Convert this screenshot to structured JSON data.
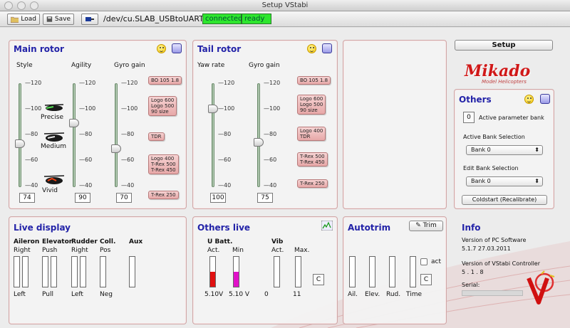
{
  "window": {
    "title": "Setup VStabi"
  },
  "toolbar": {
    "load_label": "Load",
    "save_label": "Save",
    "path": "/dev/cu.SLAB_USBtoUART",
    "status_connected": "connected",
    "status_ready": "ready"
  },
  "main_rotor": {
    "title": "Main rotor",
    "cols": {
      "style": "Style",
      "agility": "Agility",
      "gyro": "Gyro gain"
    },
    "ticks": [
      "120",
      "100",
      "80",
      "60",
      "40"
    ],
    "style_labels": {
      "precise": "Precise",
      "medium": "Medium",
      "vivid": "Vivid"
    },
    "values": {
      "style": "74",
      "agility": "90",
      "gyro": "70"
    },
    "gyro_tags": [
      "BO 105 1.8",
      "Logo 600\nLogo 500\n90 size",
      "TDR",
      "Logo 400\nT-Rex 500\nT-Rex 450",
      "T-Rex 250"
    ]
  },
  "tail_rotor": {
    "title": "Tail rotor",
    "cols": {
      "yaw": "Yaw rate",
      "gyro": "Gyro gain"
    },
    "ticks": [
      "120",
      "100",
      "80",
      "60",
      "40"
    ],
    "values": {
      "yaw": "100",
      "gyro": "75"
    },
    "gyro_tags": [
      "BO 105 1.8",
      "Logo 600\nLogo 500\n90 size",
      "Logo 400\nTDR",
      "T-Rex 500\nT-Rex 450",
      "T-Rex 250"
    ]
  },
  "setup": {
    "button_label": "Setup",
    "brand": "Mikado",
    "brand_sub": "Model Helicopters"
  },
  "others": {
    "title": "Others",
    "bank_value": "0",
    "active_param_label": "Active parameter bank",
    "active_bank_label": "Active Bank Selection",
    "active_bank_value": "Bank 0",
    "edit_bank_label": "Edit Bank Selection",
    "edit_bank_value": "Bank 0",
    "coldstart_label": "Coldstart (Recalibrate)"
  },
  "live_display": {
    "title": "Live display",
    "cols": [
      {
        "name": "Aileron",
        "top": "Right",
        "bottom": "Left"
      },
      {
        "name": "Elevator",
        "top": "Push",
        "bottom": "Pull"
      },
      {
        "name": "Rudder",
        "top": "Right",
        "bottom": "Left"
      },
      {
        "name": "Coll.",
        "top": "Pos",
        "bottom": "Neg"
      },
      {
        "name": "Aux",
        "top": "",
        "bottom": ""
      }
    ]
  },
  "others_live": {
    "title": "Others live",
    "ubatt": "U Batt.",
    "act": "Act.",
    "min": "Min",
    "vib": "Vib",
    "vib_act": "Act.",
    "vib_max": "Max.",
    "act_value": "5.10V",
    "min_value": "5.10 V",
    "vib_act_value": "0",
    "vib_max_value": "11",
    "clear_label": "C",
    "batt_act_level": 0.5,
    "batt_min_level": 0.5,
    "colors": {
      "act": "#e01010",
      "min": "#e010c8"
    }
  },
  "autotrim": {
    "title": "Autotrim",
    "trim_label": "Trim",
    "act_label": "act",
    "clear_label": "C",
    "bars": [
      "Ail.",
      "Elev.",
      "Rud.",
      "Time"
    ]
  },
  "info": {
    "title": "Info",
    "pc_label": "Version of PC Software",
    "pc_value": "5.1.7 27.03.2011",
    "ctrl_label": "Version of VStabi Controller",
    "ctrl_value": "5 . 1 . 8",
    "serial_label": "Serial:"
  }
}
